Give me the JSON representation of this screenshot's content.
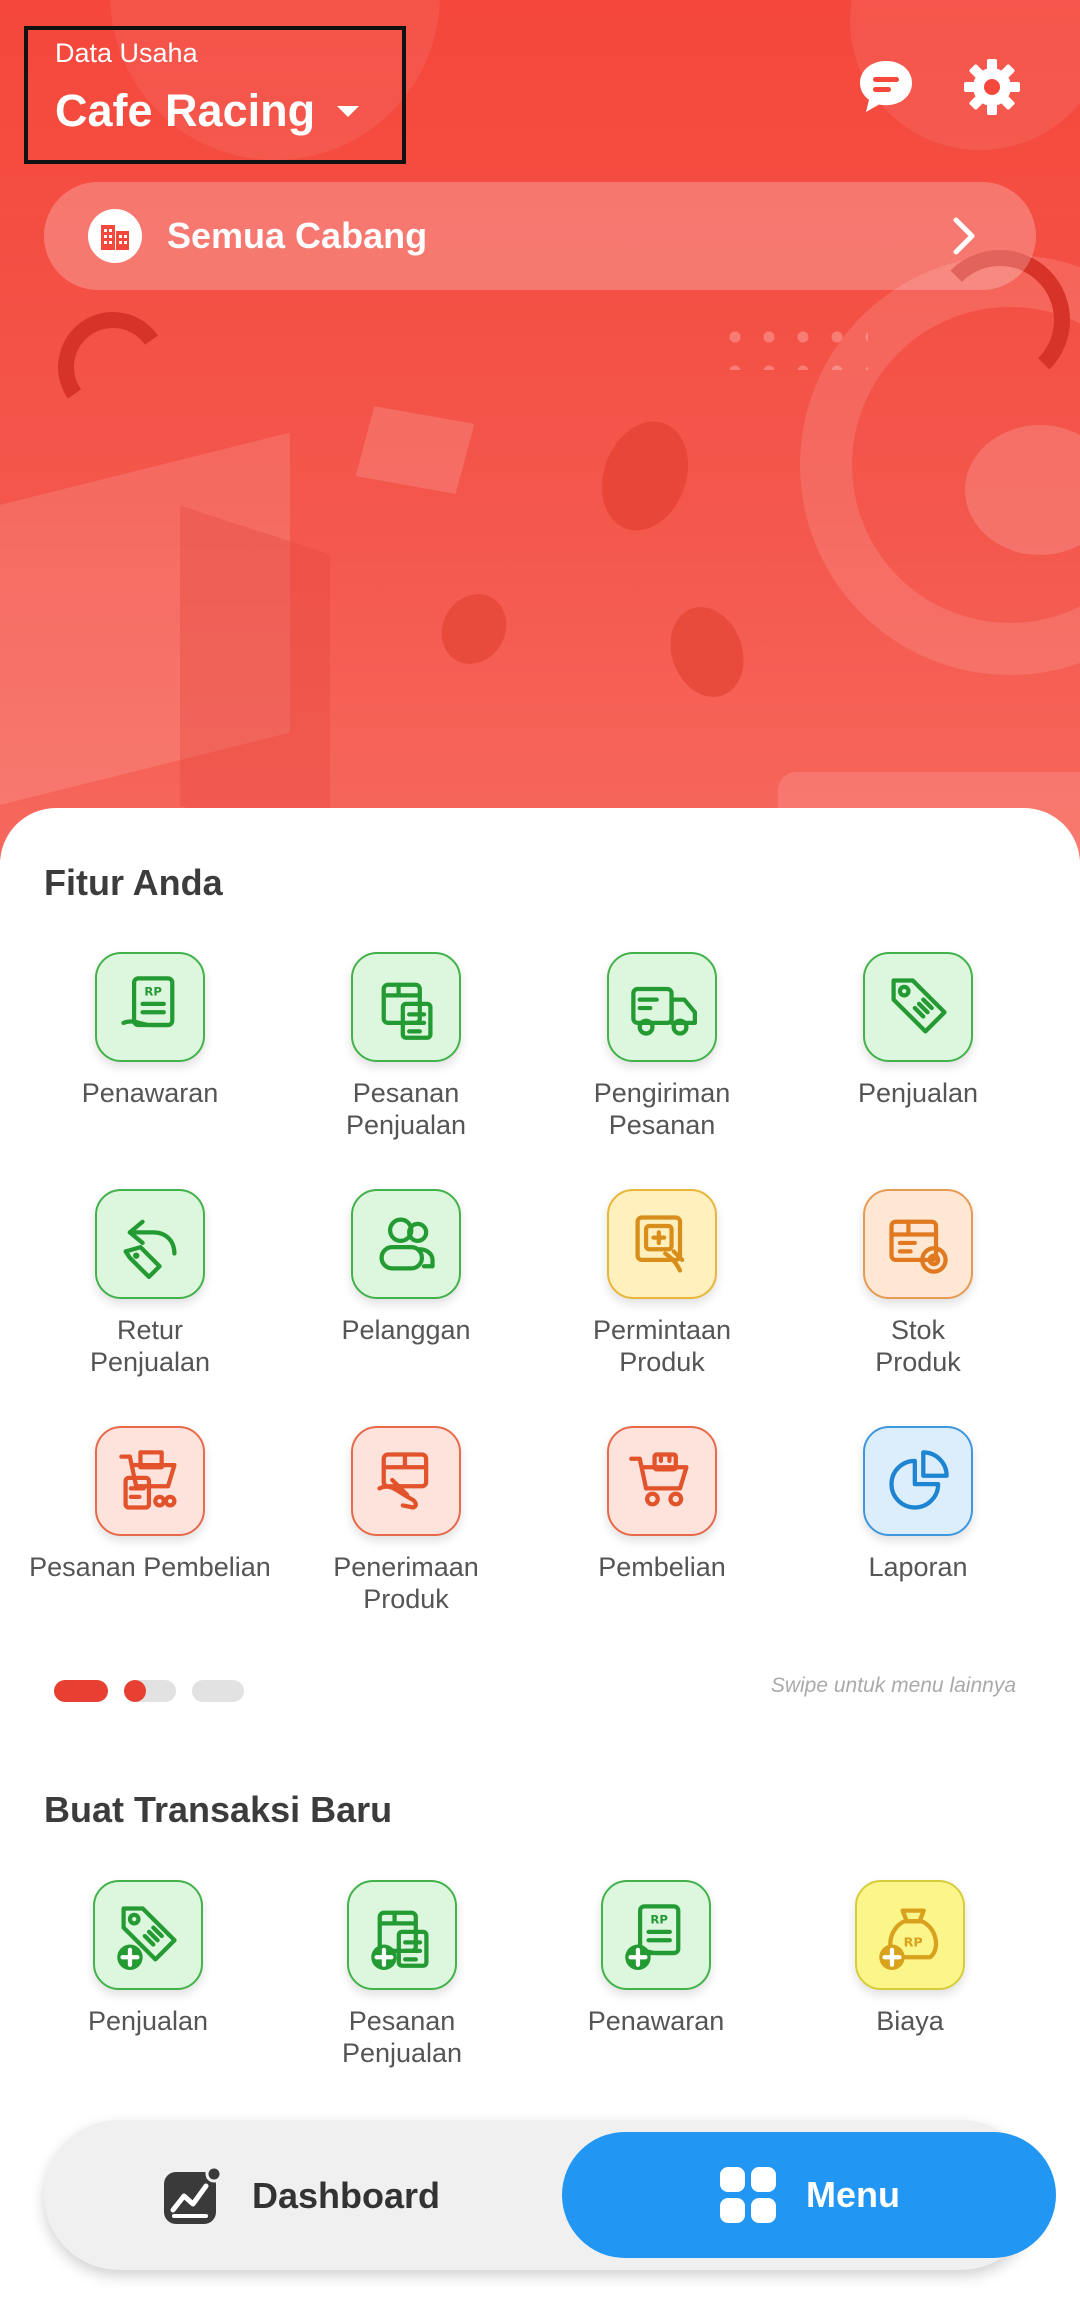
{
  "header": {
    "business_label": "Data Usaha",
    "business_name": "Cafe Racing",
    "branch_label": "Semua Cabang"
  },
  "features": {
    "title": "Fitur Anda",
    "items": [
      {
        "label": "Penawaran",
        "color": "green",
        "icon": "quote-receipt-icon"
      },
      {
        "label": "Pesanan\nPenjualan",
        "color": "green",
        "icon": "sales-order-icon"
      },
      {
        "label": "Pengiriman\nPesanan",
        "color": "green",
        "icon": "delivery-truck-icon"
      },
      {
        "label": "Penjualan",
        "color": "green",
        "icon": "price-tag-icon"
      },
      {
        "label": "Retur\nPenjualan",
        "color": "green",
        "icon": "return-tag-icon"
      },
      {
        "label": "Pelanggan",
        "color": "green",
        "icon": "customers-icon"
      },
      {
        "label": "Permintaan\nProduk",
        "color": "yellow",
        "icon": "product-request-icon"
      },
      {
        "label": "Stok\nProduk",
        "color": "orange",
        "icon": "stock-box-icon"
      },
      {
        "label": "Pesanan Pembelian",
        "color": "red",
        "icon": "purchase-order-icon"
      },
      {
        "label": "Penerimaan\nProduk",
        "color": "red",
        "icon": "receive-product-icon"
      },
      {
        "label": "Pembelian",
        "color": "red",
        "icon": "cart-icon"
      },
      {
        "label": "Laporan",
        "color": "blue",
        "icon": "pie-chart-icon"
      }
    ],
    "swipe_hint": "Swipe untuk menu lainnya"
  },
  "new_transaction": {
    "title": "Buat Transaksi Baru",
    "items": [
      {
        "label": "Penjualan",
        "color": "green",
        "icon": "add-sale-icon"
      },
      {
        "label": "Pesanan\nPenjualan",
        "color": "green",
        "icon": "add-sales-order-icon"
      },
      {
        "label": "Penawaran",
        "color": "green",
        "icon": "add-quote-icon"
      },
      {
        "label": "Biaya",
        "color": "lemon",
        "icon": "add-expense-icon"
      }
    ]
  },
  "bottom_nav": {
    "dashboard_label": "Dashboard",
    "menu_label": "Menu"
  },
  "colors": {
    "primary_red": "#f5473b",
    "menu_blue": "#2196f3"
  }
}
